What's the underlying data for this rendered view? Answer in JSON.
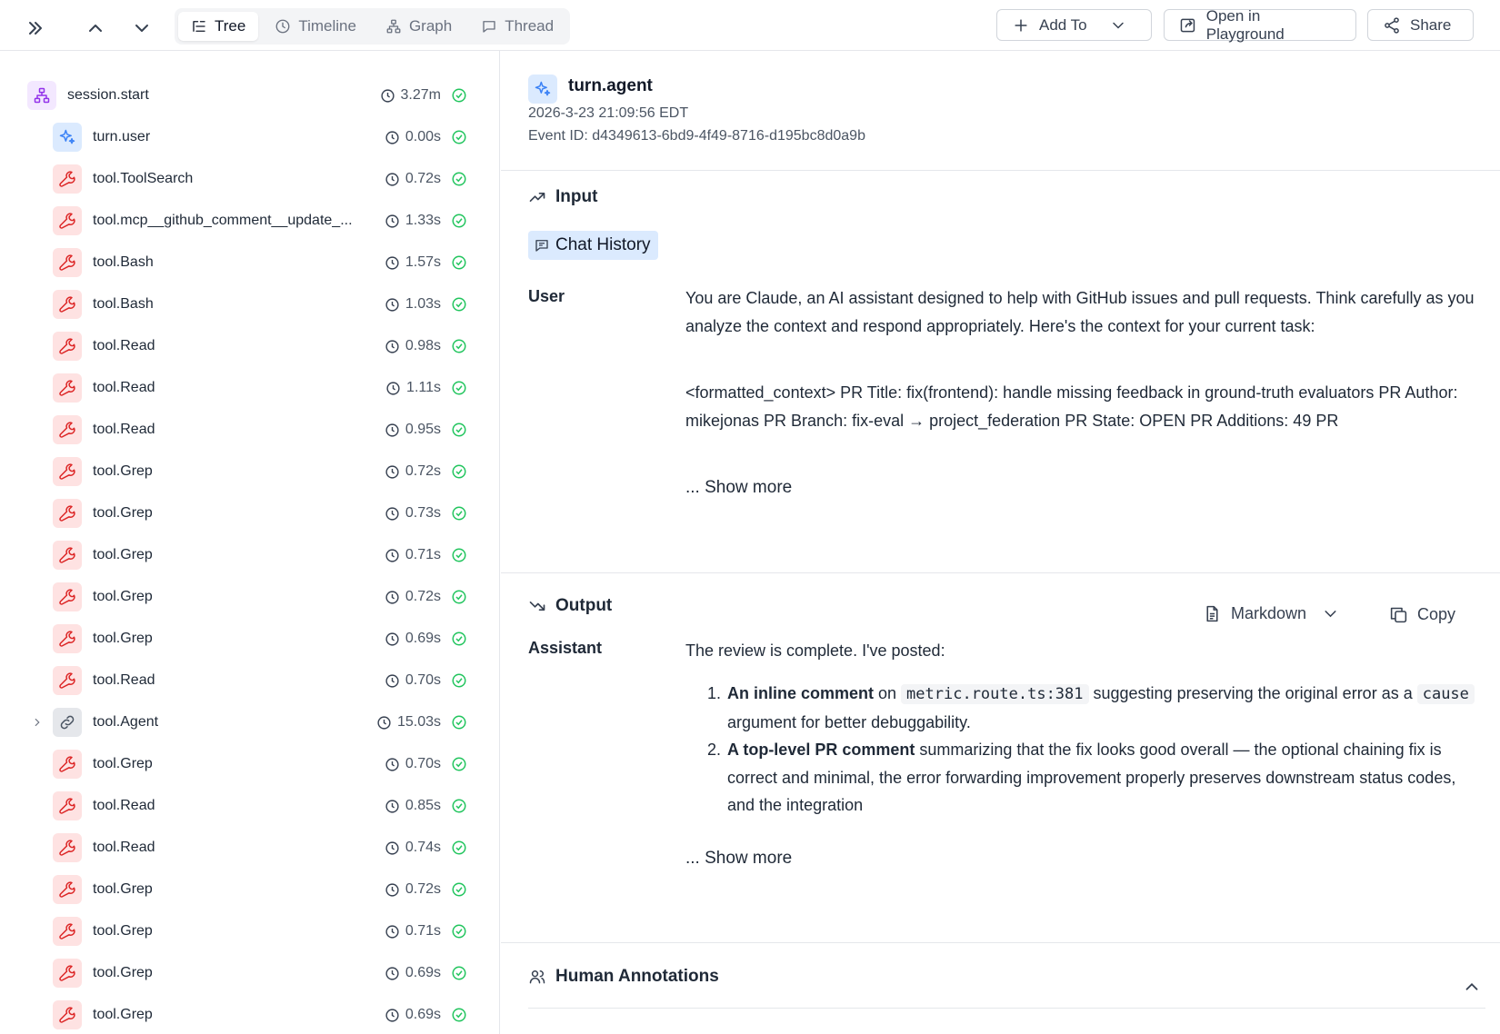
{
  "toolbar": {
    "tabs": [
      {
        "label": "Tree",
        "icon": "tree-icon",
        "active": true
      },
      {
        "label": "Timeline",
        "icon": "clock-icon",
        "active": false
      },
      {
        "label": "Graph",
        "icon": "graph-icon",
        "active": false
      },
      {
        "label": "Thread",
        "icon": "thread-icon",
        "active": false
      }
    ],
    "add_to_label": "Add To",
    "playground_label": "Open in Playground",
    "share_label": "Share"
  },
  "tree": {
    "root": {
      "name": "session.start",
      "duration": "3.27m",
      "icon": "sitemap-icon"
    },
    "items": [
      {
        "name": "turn.user",
        "duration": "0.00s",
        "kind": "user"
      },
      {
        "name": "tool.ToolSearch",
        "duration": "0.72s",
        "kind": "tool"
      },
      {
        "name": "tool.mcp__github_comment__update_...",
        "duration": "1.33s",
        "kind": "tool"
      },
      {
        "name": "tool.Bash",
        "duration": "1.57s",
        "kind": "tool"
      },
      {
        "name": "tool.Bash",
        "duration": "1.03s",
        "kind": "tool"
      },
      {
        "name": "tool.Read",
        "duration": "0.98s",
        "kind": "tool"
      },
      {
        "name": "tool.Read",
        "duration": "1.11s",
        "kind": "tool"
      },
      {
        "name": "tool.Read",
        "duration": "0.95s",
        "kind": "tool"
      },
      {
        "name": "tool.Grep",
        "duration": "0.72s",
        "kind": "tool"
      },
      {
        "name": "tool.Grep",
        "duration": "0.73s",
        "kind": "tool"
      },
      {
        "name": "tool.Grep",
        "duration": "0.71s",
        "kind": "tool"
      },
      {
        "name": "tool.Grep",
        "duration": "0.72s",
        "kind": "tool"
      },
      {
        "name": "tool.Grep",
        "duration": "0.69s",
        "kind": "tool"
      },
      {
        "name": "tool.Read",
        "duration": "0.70s",
        "kind": "tool"
      },
      {
        "name": "tool.Agent",
        "duration": "15.03s",
        "kind": "agent"
      },
      {
        "name": "tool.Grep",
        "duration": "0.70s",
        "kind": "tool"
      },
      {
        "name": "tool.Read",
        "duration": "0.85s",
        "kind": "tool"
      },
      {
        "name": "tool.Read",
        "duration": "0.74s",
        "kind": "tool"
      },
      {
        "name": "tool.Grep",
        "duration": "0.72s",
        "kind": "tool"
      },
      {
        "name": "tool.Grep",
        "duration": "0.71s",
        "kind": "tool"
      },
      {
        "name": "tool.Grep",
        "duration": "0.69s",
        "kind": "tool"
      },
      {
        "name": "tool.Grep",
        "duration": "0.69s",
        "kind": "tool"
      }
    ]
  },
  "detail": {
    "title": "turn.agent",
    "datetime": "2026-3-23 21:09:56 EDT",
    "event_id": "Event ID: d4349613-6bd9-4f49-8716-d195bc8d0a9b",
    "input": {
      "heading": "Input",
      "chip_label": "Chat History",
      "role": "User",
      "paragraph1": "You are Claude, an AI assistant designed to help with GitHub issues and pull requests. Think carefully as you analyze the context and respond appropriately. Here's the context for your current task:",
      "paragraph2": "<formatted_context> PR Title: fix(frontend): handle missing feedback in ground-truth evaluators PR Author: mikejonas PR Branch: fix-eval → project_federation PR State: OPEN PR Additions: 49 PR",
      "show_more": "... Show more"
    },
    "output": {
      "heading": "Output",
      "format_label": "Markdown",
      "copy_label": "Copy",
      "role": "Assistant",
      "intro": "The review is complete. I've posted:",
      "item1": {
        "num": "1.",
        "bold": "An inline comment",
        "t1": " on ",
        "code1": "metric.route.ts:381",
        "t2": " suggesting preserving the original error as a ",
        "code2": "cause",
        "t3": " argument for better debuggability."
      },
      "item2": {
        "num": "2.",
        "bold": "A top-level PR comment",
        "text": " summarizing that the fix looks good overall — the optional chaining fix is correct and minimal, the error forwarding improvement properly preserves downstream status codes, and the integration"
      },
      "show_more": "... Show more"
    },
    "annotations": {
      "heading": "Human Annotations"
    }
  },
  "colors": {
    "accent": "#3b82f6",
    "tool": "#dc2626",
    "session": "#9333ea",
    "success": "#22c55e"
  }
}
